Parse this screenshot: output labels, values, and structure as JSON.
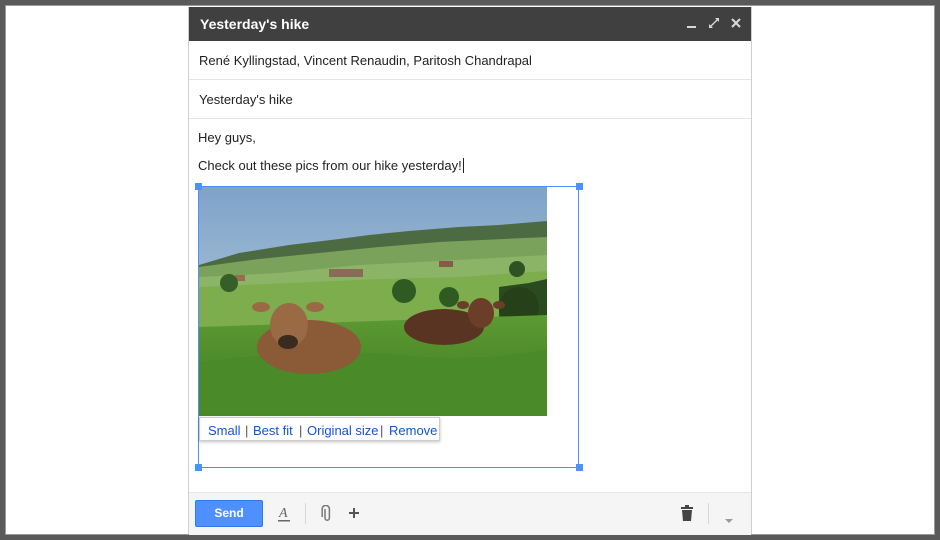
{
  "window": {
    "title": "Yesterday's hike"
  },
  "recipients": "René Kyllingstad, Vincent Renaudin, Paritosh Chandrapal",
  "subject": "Yesterday's hike",
  "body": {
    "greeting": "Hey guys,",
    "message": "Check out these pics from our hike yesterday!"
  },
  "image_menu": {
    "small": "Small",
    "best_fit": "Best fit",
    "original_size": "Original size",
    "remove": "Remove",
    "separator": "|"
  },
  "toolbar": {
    "send_label": "Send",
    "formatting_icon": "format-text-icon",
    "attach_icon": "paperclip-icon",
    "more_icon": "plus-icon",
    "discard_icon": "trash-icon",
    "options_icon": "dropdown-arrow-icon"
  },
  "colors": {
    "titlebar": "#404040",
    "send_button": "#4d90fe",
    "selection": "#4d90fe",
    "link": "#1155cc"
  }
}
